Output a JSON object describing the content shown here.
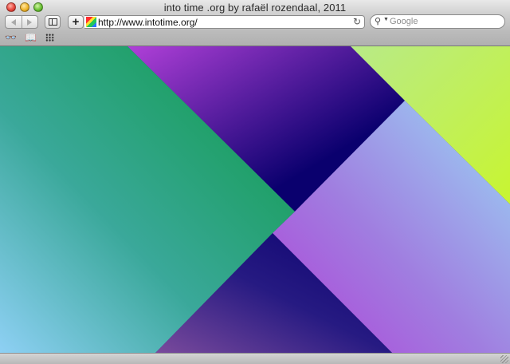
{
  "window": {
    "title": "into time .org by rafaël rozendaal, 2011"
  },
  "toolbar": {
    "address": "http://www.intotime.org/",
    "search_placeholder": "Google"
  },
  "bookmarks_bar": {
    "reading_list_icon": "glasses-icon",
    "bookmarks_icon": "book-icon",
    "top_sites_icon": "grid-icon"
  },
  "artwork": {
    "colors": {
      "green": "#0f9a4a",
      "light_blue": "#8ed0f4",
      "violet": "#b040d8",
      "navy": "#0a006e",
      "lime": "#c8f530",
      "pale_green": "#b8ea88"
    }
  }
}
